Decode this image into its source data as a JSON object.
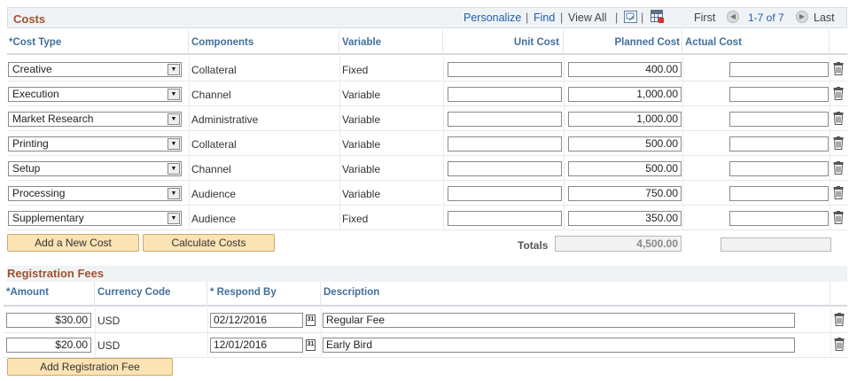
{
  "costs": {
    "title": "Costs",
    "nav": {
      "personalize": "Personalize",
      "find": "Find",
      "view_all": "View All",
      "first": "First",
      "range": "1-7 of 7",
      "last": "Last"
    },
    "headers": {
      "cost_type": "*Cost Type",
      "components": "Components",
      "variable": "Variable",
      "unit_cost": "Unit Cost",
      "planned_cost": "Planned Cost",
      "actual_cost": "Actual Cost"
    },
    "rows": [
      {
        "cost_type": "Creative",
        "component": "Collateral",
        "variable": "Fixed",
        "unit_cost": "",
        "planned_cost": "400.00",
        "actual_cost": ""
      },
      {
        "cost_type": "Execution",
        "component": "Channel",
        "variable": "Variable",
        "unit_cost": "",
        "planned_cost": "1,000.00",
        "actual_cost": ""
      },
      {
        "cost_type": "Market Research",
        "component": "Administrative",
        "variable": "Variable",
        "unit_cost": "",
        "planned_cost": "1,000.00",
        "actual_cost": ""
      },
      {
        "cost_type": "Printing",
        "component": "Collateral",
        "variable": "Variable",
        "unit_cost": "",
        "planned_cost": "500.00",
        "actual_cost": ""
      },
      {
        "cost_type": "Setup",
        "component": "Channel",
        "variable": "Variable",
        "unit_cost": "",
        "planned_cost": "500.00",
        "actual_cost": ""
      },
      {
        "cost_type": "Processing",
        "component": "Audience",
        "variable": "Variable",
        "unit_cost": "",
        "planned_cost": "750.00",
        "actual_cost": ""
      },
      {
        "cost_type": "Supplementary",
        "component": "Audience",
        "variable": "Fixed",
        "unit_cost": "",
        "planned_cost": "350.00",
        "actual_cost": ""
      }
    ],
    "add_button": "Add a New Cost",
    "calc_button": "Calculate Costs",
    "totals_label": "Totals",
    "total_planned": "4,500.00",
    "total_actual": ""
  },
  "registration": {
    "title": "Registration Fees",
    "headers": {
      "amount": "*Amount",
      "currency": "Currency Code",
      "respond_by": "* Respond By",
      "description": "Description"
    },
    "rows": [
      {
        "amount": "$30.00",
        "currency": "USD",
        "respond_by": "02/12/2016",
        "description": "Regular Fee"
      },
      {
        "amount": "$20.00",
        "currency": "USD",
        "respond_by": "12/01/2016",
        "description": "Early Bird"
      }
    ],
    "add_button": "Add Registration Fee"
  },
  "colors": {
    "section_title": "#a0522d",
    "column_header": "#426f9b",
    "link": "#1f5fa8",
    "button_bg": "#fbe3b3"
  }
}
